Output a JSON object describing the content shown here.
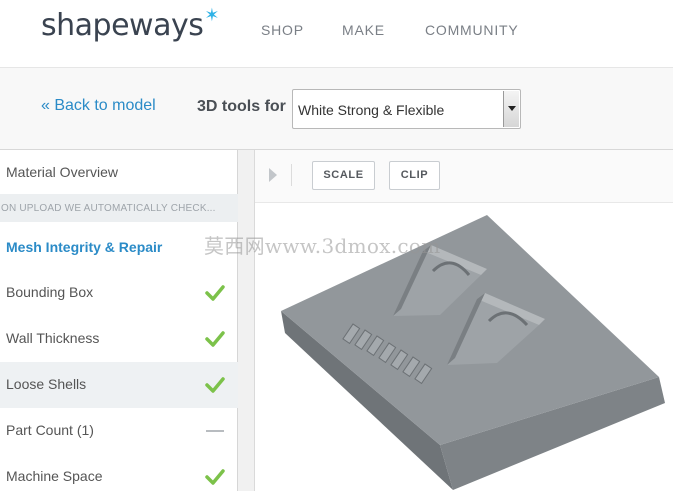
{
  "header": {
    "logo_text": "shapeways",
    "logo_star": "✶",
    "nav": [
      "SHOP",
      "MAKE",
      "COMMUNITY"
    ]
  },
  "toolbar": {
    "back_link": "« Back to model",
    "tools_label": "3D tools for",
    "material_select": "White Strong & Flexible"
  },
  "sidebar": {
    "overview": "Material Overview",
    "note": "ON UPLOAD WE AUTOMATICALLY CHECK...",
    "section_title": "Mesh Integrity & Repair",
    "checks": [
      {
        "label": "Bounding Box",
        "status": "check-icon"
      },
      {
        "label": "Wall Thickness",
        "status": "check-icon"
      },
      {
        "label": "Loose Shells",
        "status": "check-icon"
      },
      {
        "label": "Part Count (1)",
        "status": "dash-icon"
      },
      {
        "label": "Machine Space",
        "status": "check-icon"
      }
    ]
  },
  "viewer": {
    "buttons": [
      "SCALE",
      "CLIP"
    ]
  },
  "watermark": "莫西网www.3dmox.com",
  "colors": {
    "accent_blue": "#2b8bc7",
    "check_green": "#7cc24a",
    "logo_star": "#2fb2e6",
    "model_gray": "#8f9498"
  }
}
